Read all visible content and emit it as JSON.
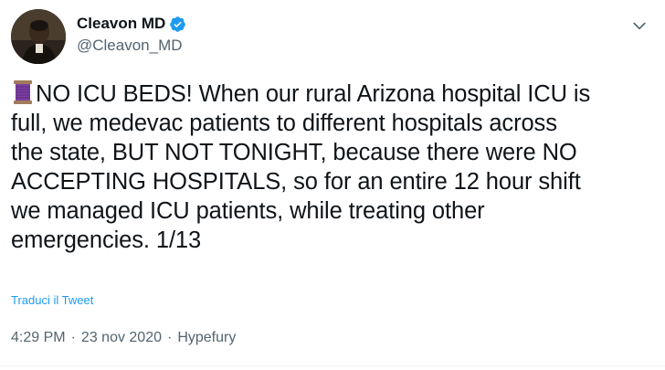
{
  "tweet": {
    "display_name": "Cleavon MD",
    "handle": "@Cleavon_MD",
    "emoji": "spool-of-thread-emoji",
    "text_lines": [
      "NO ICU BEDS! When our rural Arizona hospital ICU is",
      "full, we medevac patients to different hospitals across",
      "the state, BUT NOT TONIGHT, because there were NO",
      "ACCEPTING HOSPITALS, so for an entire 12 hour shift",
      "we managed ICU patients, while treating other",
      "emergencies. 1/13"
    ],
    "translate_label": "Traduci il Tweet",
    "time": "4:29 PM",
    "date": "23 nov 2020",
    "separator": "·",
    "source": "Hypefury"
  },
  "icons": {
    "verified": "verified-badge-icon",
    "caret": "chevron-down-icon",
    "avatar": "avatar"
  },
  "colors": {
    "accent": "#1d9bf0",
    "text": "#0f1419",
    "muted": "#536471",
    "emoji_purple": "#7b3fa1"
  }
}
